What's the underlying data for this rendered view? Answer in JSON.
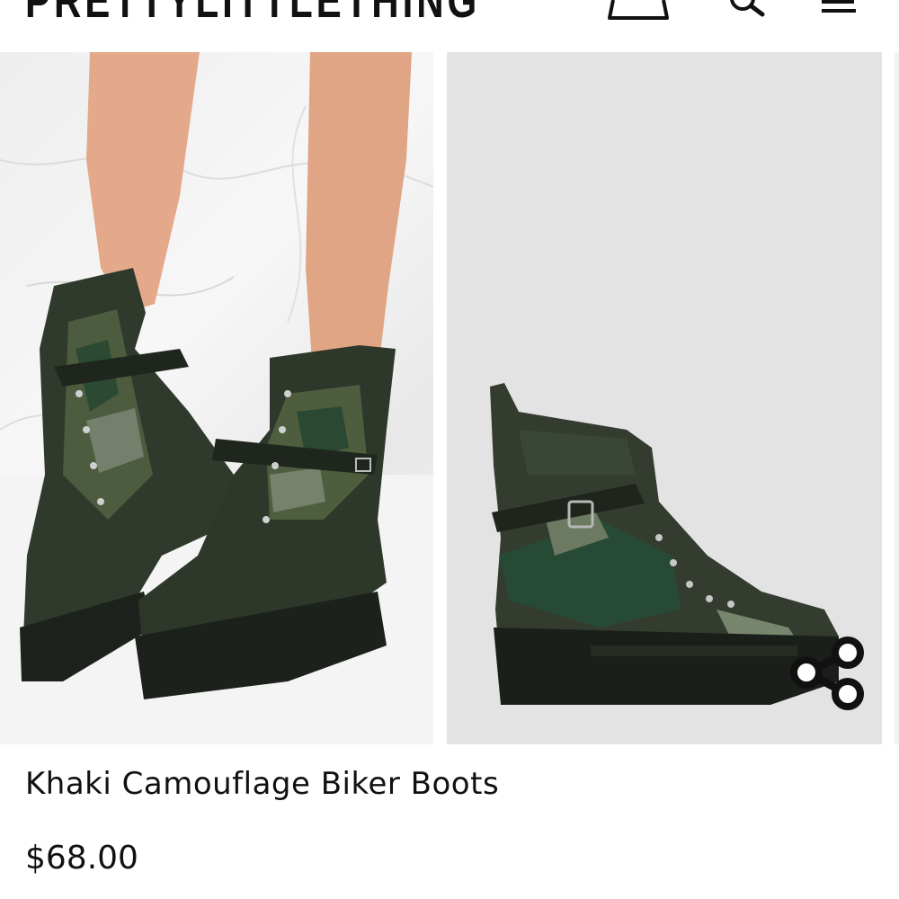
{
  "header": {
    "logo_text": "PRETTYLITTLETHING",
    "icons": [
      "bag-icon",
      "search-icon",
      "menu-icon"
    ]
  },
  "gallery": {
    "images": [
      {
        "name": "product-image-worn",
        "alt": "Model wearing khaki camouflage lace-up biker boots"
      },
      {
        "name": "product-image-side",
        "alt": "Khaki camouflage biker boot side view"
      }
    ],
    "share_icon": "share-icon"
  },
  "product": {
    "title": "Khaki Camouflage Biker Boots",
    "price": "$68.00"
  },
  "colors": {
    "text": "#111111",
    "background": "#ffffff",
    "image_backdrop": "#e3e3e3"
  }
}
